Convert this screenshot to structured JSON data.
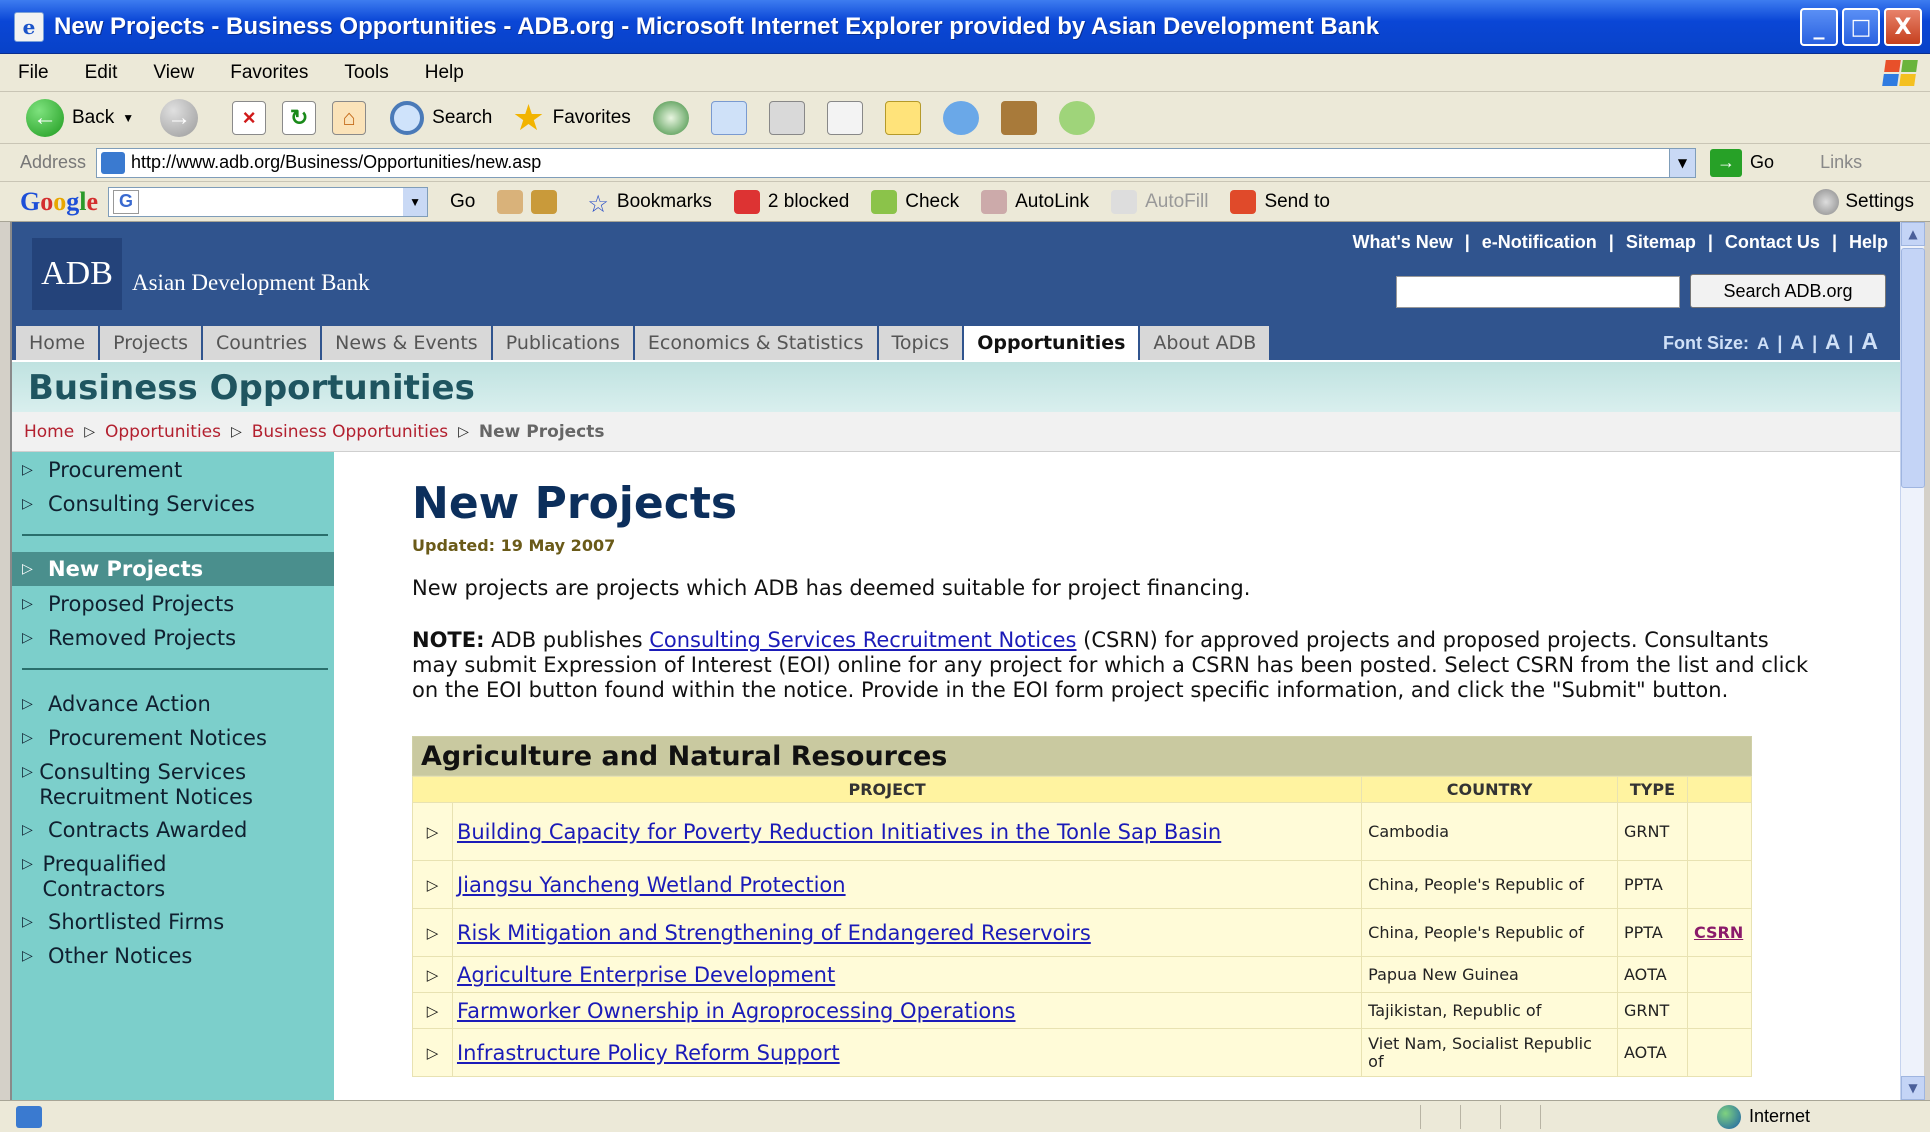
{
  "window": {
    "title": "New Projects - Business Opportunities - ADB.org - Microsoft Internet Explorer provided by Asian Development Bank",
    "controls": [
      "_",
      "□",
      "X"
    ]
  },
  "menu": [
    "File",
    "Edit",
    "View",
    "Favorites",
    "Tools",
    "Help"
  ],
  "toolbar": {
    "back_label": "Back",
    "search_label": "Search",
    "favorites_label": "Favorites"
  },
  "address": {
    "label": "Address",
    "url": "http://www.adb.org/Business/Opportunities/new.asp",
    "go_label": "Go",
    "links_label": "Links"
  },
  "google_bar": {
    "logo": "Google",
    "go_label": "Go",
    "bookmarks_label": "Bookmarks",
    "blocked_label": "2 blocked",
    "check_label": "Check",
    "autolink_label": "AutoLink",
    "autofill_label": "AutoFill",
    "sendto_label": "Send to",
    "settings_label": "Settings"
  },
  "site": {
    "logo_text": "ADB",
    "org_name": "Asian Development Bank",
    "utility_links": [
      "What's New",
      "e-Notification",
      "Sitemap",
      "Contact Us",
      "Help"
    ],
    "search_button": "Search ADB.org",
    "nav_tabs": [
      "Home",
      "Projects",
      "Countries",
      "News & Events",
      "Publications",
      "Economics & Statistics",
      "Topics",
      "Opportunities",
      "About ADB"
    ],
    "active_tab": "Opportunities",
    "font_size_label": "Font Size:",
    "font_sizes": [
      "A",
      "A",
      "A",
      "A"
    ],
    "section_title": "Business Opportunities",
    "breadcrumb": [
      "Home",
      "Opportunities",
      "Business Opportunities",
      "New Projects"
    ]
  },
  "left_nav": {
    "group1": [
      "Procurement",
      "Consulting Services"
    ],
    "group2": [
      "New Projects",
      "Proposed Projects",
      "Removed Projects"
    ],
    "group3": [
      "Advance Action",
      "Procurement Notices",
      "Consulting Services Recruitment Notices",
      "Contracts Awarded",
      "Prequalified Contractors",
      "Shortlisted Firms",
      "Other Notices"
    ]
  },
  "content": {
    "title": "New Projects",
    "updated": "Updated: 19 May 2007",
    "intro": "New projects are projects which ADB has deemed suitable for project financing.",
    "note_label": "NOTE:",
    "note_pre": " ADB publishes ",
    "note_link": "Consulting Services Recruitment Notices",
    "note_post": " (CSRN) for approved projects and proposed projects. Consultants may submit Expression of Interest (EOI) online for any project for which a CSRN has been posted. Select CSRN from the list and click on the EOI button found within the notice. Provide in the EOI form project specific information, and click the \"Submit\" button."
  },
  "sector": {
    "name": "Agriculture and Natural Resources",
    "columns": [
      "PROJECT",
      "COUNTRY",
      "TYPE"
    ],
    "rows": [
      {
        "project": "Building Capacity for Poverty Reduction Initiatives in the Tonle Sap Basin",
        "country": "Cambodia",
        "type": "GRNT",
        "extra": ""
      },
      {
        "project": "Jiangsu Yancheng Wetland Protection",
        "country": "China, People's Republic of",
        "type": "PPTA",
        "extra": ""
      },
      {
        "project": "Risk Mitigation and Strengthening of Endangered Reservoirs",
        "country": "China, People's Republic of",
        "type": "PPTA",
        "extra": "CSRN"
      },
      {
        "project": "Agriculture Enterprise Development",
        "country": "Papua New Guinea",
        "type": "AOTA",
        "extra": ""
      },
      {
        "project": "Farmworker Ownership in Agroprocessing Operations",
        "country": "Tajikistan, Republic of",
        "type": "GRNT",
        "extra": ""
      },
      {
        "project": "Infrastructure Policy Reform Support",
        "country": "Viet Nam, Socialist Republic of",
        "type": "AOTA",
        "extra": ""
      }
    ]
  },
  "status": {
    "zone": "Internet"
  }
}
